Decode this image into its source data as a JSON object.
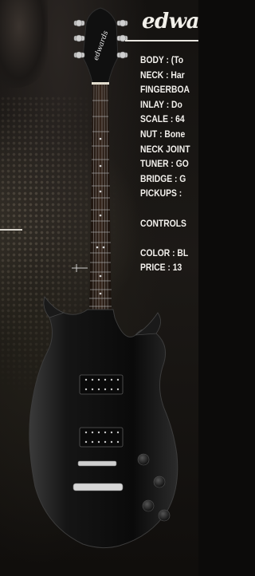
{
  "brand": {
    "logo_text": "edwa",
    "headstock_logo_text": "edwards"
  },
  "specs": [
    {
      "key": "body",
      "text": "BODY : (To"
    },
    {
      "key": "neck",
      "text": "NECK : Har"
    },
    {
      "key": "fingerboard",
      "text": "FINGERBOA"
    },
    {
      "key": "inlay",
      "text": "INLAY : Do"
    },
    {
      "key": "scale",
      "text": "SCALE : 64"
    },
    {
      "key": "nut",
      "text": "NUT : Bone"
    },
    {
      "key": "neck_joint",
      "text": "NECK JOINT"
    },
    {
      "key": "tuner",
      "text": "TUNER : GO"
    },
    {
      "key": "bridge",
      "text": "BRIDGE : G"
    },
    {
      "key": "pickups",
      "text": "PICKUPS :"
    },
    {
      "key": "blank1",
      "text": ""
    },
    {
      "key": "controls",
      "text": "CONTROLS"
    },
    {
      "key": "blank2",
      "text": ""
    },
    {
      "key": "color",
      "text": "COLOR : BL"
    },
    {
      "key": "price",
      "text": "PRICE : 13"
    }
  ],
  "colors": {
    "background": "#0c0b0a",
    "text": "#f4f2ee",
    "guitar_body": "#111111",
    "fingerboard": "#2a1d16",
    "hardware": "#c9c9c9"
  }
}
